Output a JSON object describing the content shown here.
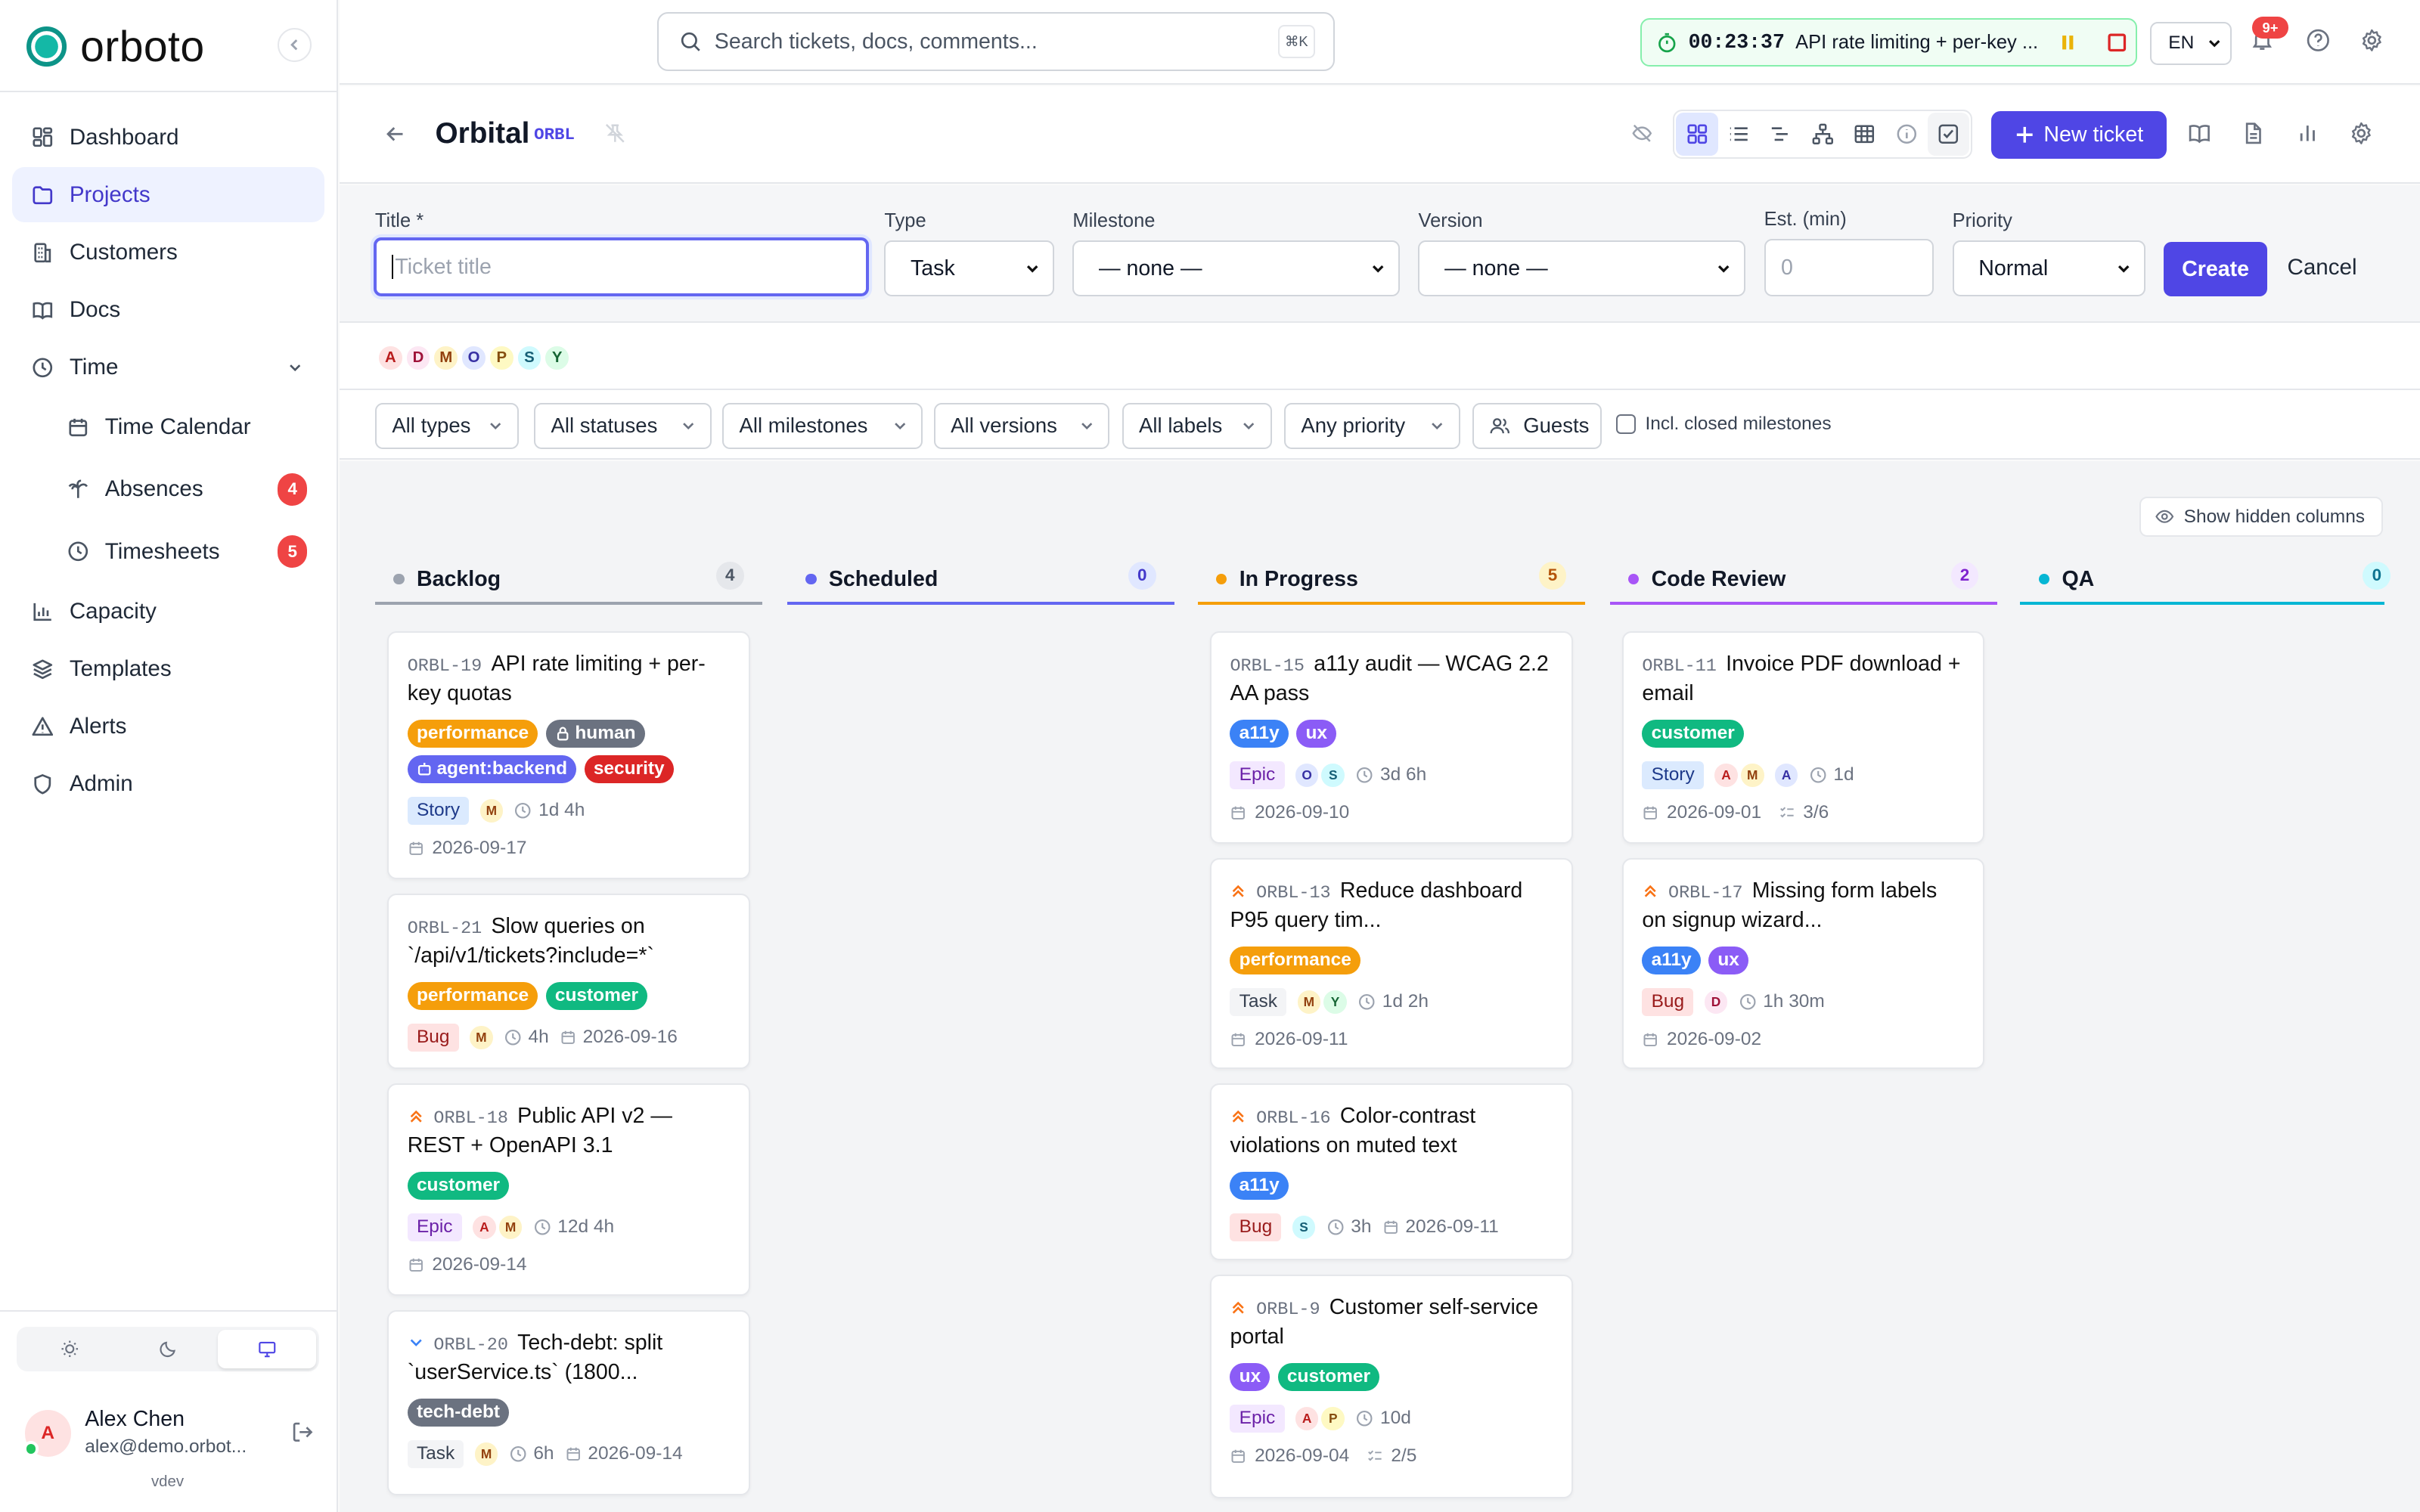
{
  "app": {
    "name": "orboto",
    "version": "vdev"
  },
  "sidebar": {
    "items": [
      {
        "label": "Dashboard",
        "icon": "dashboard-icon"
      },
      {
        "label": "Projects",
        "icon": "folder-icon"
      },
      {
        "label": "Customers",
        "icon": "building-icon"
      },
      {
        "label": "Docs",
        "icon": "book-icon"
      },
      {
        "label": "Time",
        "icon": "clock-icon"
      },
      {
        "label": "Time Calendar",
        "icon": "calendar-icon"
      },
      {
        "label": "Absences",
        "icon": "palm-tree-icon",
        "badge": "4"
      },
      {
        "label": "Timesheets",
        "icon": "clock-icon",
        "badge": "5"
      },
      {
        "label": "Capacity",
        "icon": "bar-chart-icon"
      },
      {
        "label": "Templates",
        "icon": "layers-icon"
      },
      {
        "label": "Alerts",
        "icon": "warning-icon"
      },
      {
        "label": "Admin",
        "icon": "shield-icon"
      }
    ]
  },
  "user": {
    "initial": "A",
    "name": "Alex Chen",
    "email": "alex@demo.orbot..."
  },
  "topbar": {
    "search_placeholder": "Search tickets, docs, comments...",
    "shortcut": "⌘K",
    "timer_time": "00:23:37",
    "timer_label": "API rate limiting + per-key ...",
    "lang": "EN",
    "notifications": "9+"
  },
  "project": {
    "name": "Orbital",
    "key": "ORBL",
    "new_ticket_label": "New ticket"
  },
  "form": {
    "title_label": "Title *",
    "title_placeholder": "Ticket title",
    "type_label": "Type",
    "type_value": "Task",
    "milestone_label": "Milestone",
    "milestone_value": "— none —",
    "version_label": "Version",
    "version_value": "— none —",
    "est_label": "Est. (min)",
    "est_placeholder": "0",
    "priority_label": "Priority",
    "priority_value": "Normal",
    "create_label": "Create",
    "cancel_label": "Cancel"
  },
  "members": [
    "A",
    "D",
    "M",
    "O",
    "P",
    "S",
    "Y"
  ],
  "filters": {
    "types": "All types",
    "statuses": "All statuses",
    "milestones": "All milestones",
    "versions": "All versions",
    "labels": "All labels",
    "priority": "Any priority",
    "guests": "Guests",
    "incl_closed": "Incl. closed milestones"
  },
  "board": {
    "show_hidden": "Show hidden columns",
    "columns": [
      {
        "name": "Backlog",
        "count": "4",
        "color": "#9ca3af"
      },
      {
        "name": "Scheduled",
        "count": "0",
        "color": "#6366f1"
      },
      {
        "name": "In Progress",
        "count": "5",
        "color": "#f59e0b"
      },
      {
        "name": "Code Review",
        "count": "2",
        "color": "#a855f7"
      },
      {
        "name": "QA",
        "count": "0",
        "color": "#06b6d4"
      }
    ],
    "cards": [
      {
        "key": "ORBL-19",
        "title": "API rate limiting + per-key quotas",
        "labels": [
          "performance",
          "human",
          "agent:backend",
          "security"
        ],
        "type": "Story",
        "assignees": [
          "M"
        ],
        "estimate": "1d 4h",
        "due": "2026-09-17"
      },
      {
        "key": "ORBL-21",
        "title": "Slow queries on `/api/v1/tickets?include=*`",
        "labels": [
          "performance",
          "customer"
        ],
        "type": "Bug",
        "assignees": [
          "M"
        ],
        "estimate": "4h",
        "due": "2026-09-16"
      },
      {
        "key": "ORBL-18",
        "title": "Public API v2 — REST + OpenAPI 3.1",
        "labels": [
          "customer"
        ],
        "type": "Epic",
        "assignees": [
          "A",
          "M"
        ],
        "estimate": "12d 4h",
        "due": "2026-09-14"
      },
      {
        "key": "ORBL-20",
        "title": "Tech-debt: split `userService.ts` (1800...",
        "labels": [
          "tech-debt"
        ],
        "type": "Task",
        "assignees": [
          "M"
        ],
        "estimate": "6h",
        "due": "2026-09-14"
      },
      {
        "key": "ORBL-15",
        "title": "a11y audit — WCAG 2.2 AA pass",
        "labels": [
          "a11y",
          "ux"
        ],
        "type": "Epic",
        "assignees": [
          "O",
          "S"
        ],
        "estimate": "3d 6h",
        "due": "2026-09-10"
      },
      {
        "key": "ORBL-13",
        "title": "Reduce dashboard P95 query tim...",
        "labels": [
          "performance"
        ],
        "type": "Task",
        "assignees": [
          "M",
          "Y"
        ],
        "estimate": "1d 2h",
        "due": "2026-09-11"
      },
      {
        "key": "ORBL-16",
        "title": "Color-contrast violations on muted text",
        "labels": [
          "a11y"
        ],
        "type": "Bug",
        "assignees": [
          "S"
        ],
        "estimate": "3h",
        "due": "2026-09-11"
      },
      {
        "key": "ORBL-9",
        "title": "Customer self-service portal",
        "labels": [
          "ux",
          "customer"
        ],
        "type": "Epic",
        "assignees": [
          "A",
          "P"
        ],
        "estimate": "10d",
        "due": "2026-09-04",
        "subtasks": "2/5"
      },
      {
        "key": "ORBL-11",
        "title": "Invoice PDF download + email",
        "labels": [
          "customer"
        ],
        "type": "Story",
        "assignees": [
          "A",
          "M"
        ],
        "reviewer": "A",
        "estimate": "1d",
        "due": "2026-09-01",
        "subtasks": "3/6"
      },
      {
        "key": "ORBL-17",
        "title": "Missing form labels on signup wizard...",
        "labels": [
          "a11y",
          "ux"
        ],
        "type": "Bug",
        "assignees": [
          "D"
        ],
        "estimate": "1h 30m",
        "due": "2026-09-02"
      }
    ]
  },
  "colors": {
    "accent": "#4f46e5",
    "performance": "#f59e0b",
    "customer": "#10b981",
    "security": "#dc2626",
    "agent": "#6366f1",
    "human": "#6b7280",
    "a11y": "#3b82f6",
    "ux": "#8b5cf6",
    "tech-debt": "#6b7280"
  }
}
